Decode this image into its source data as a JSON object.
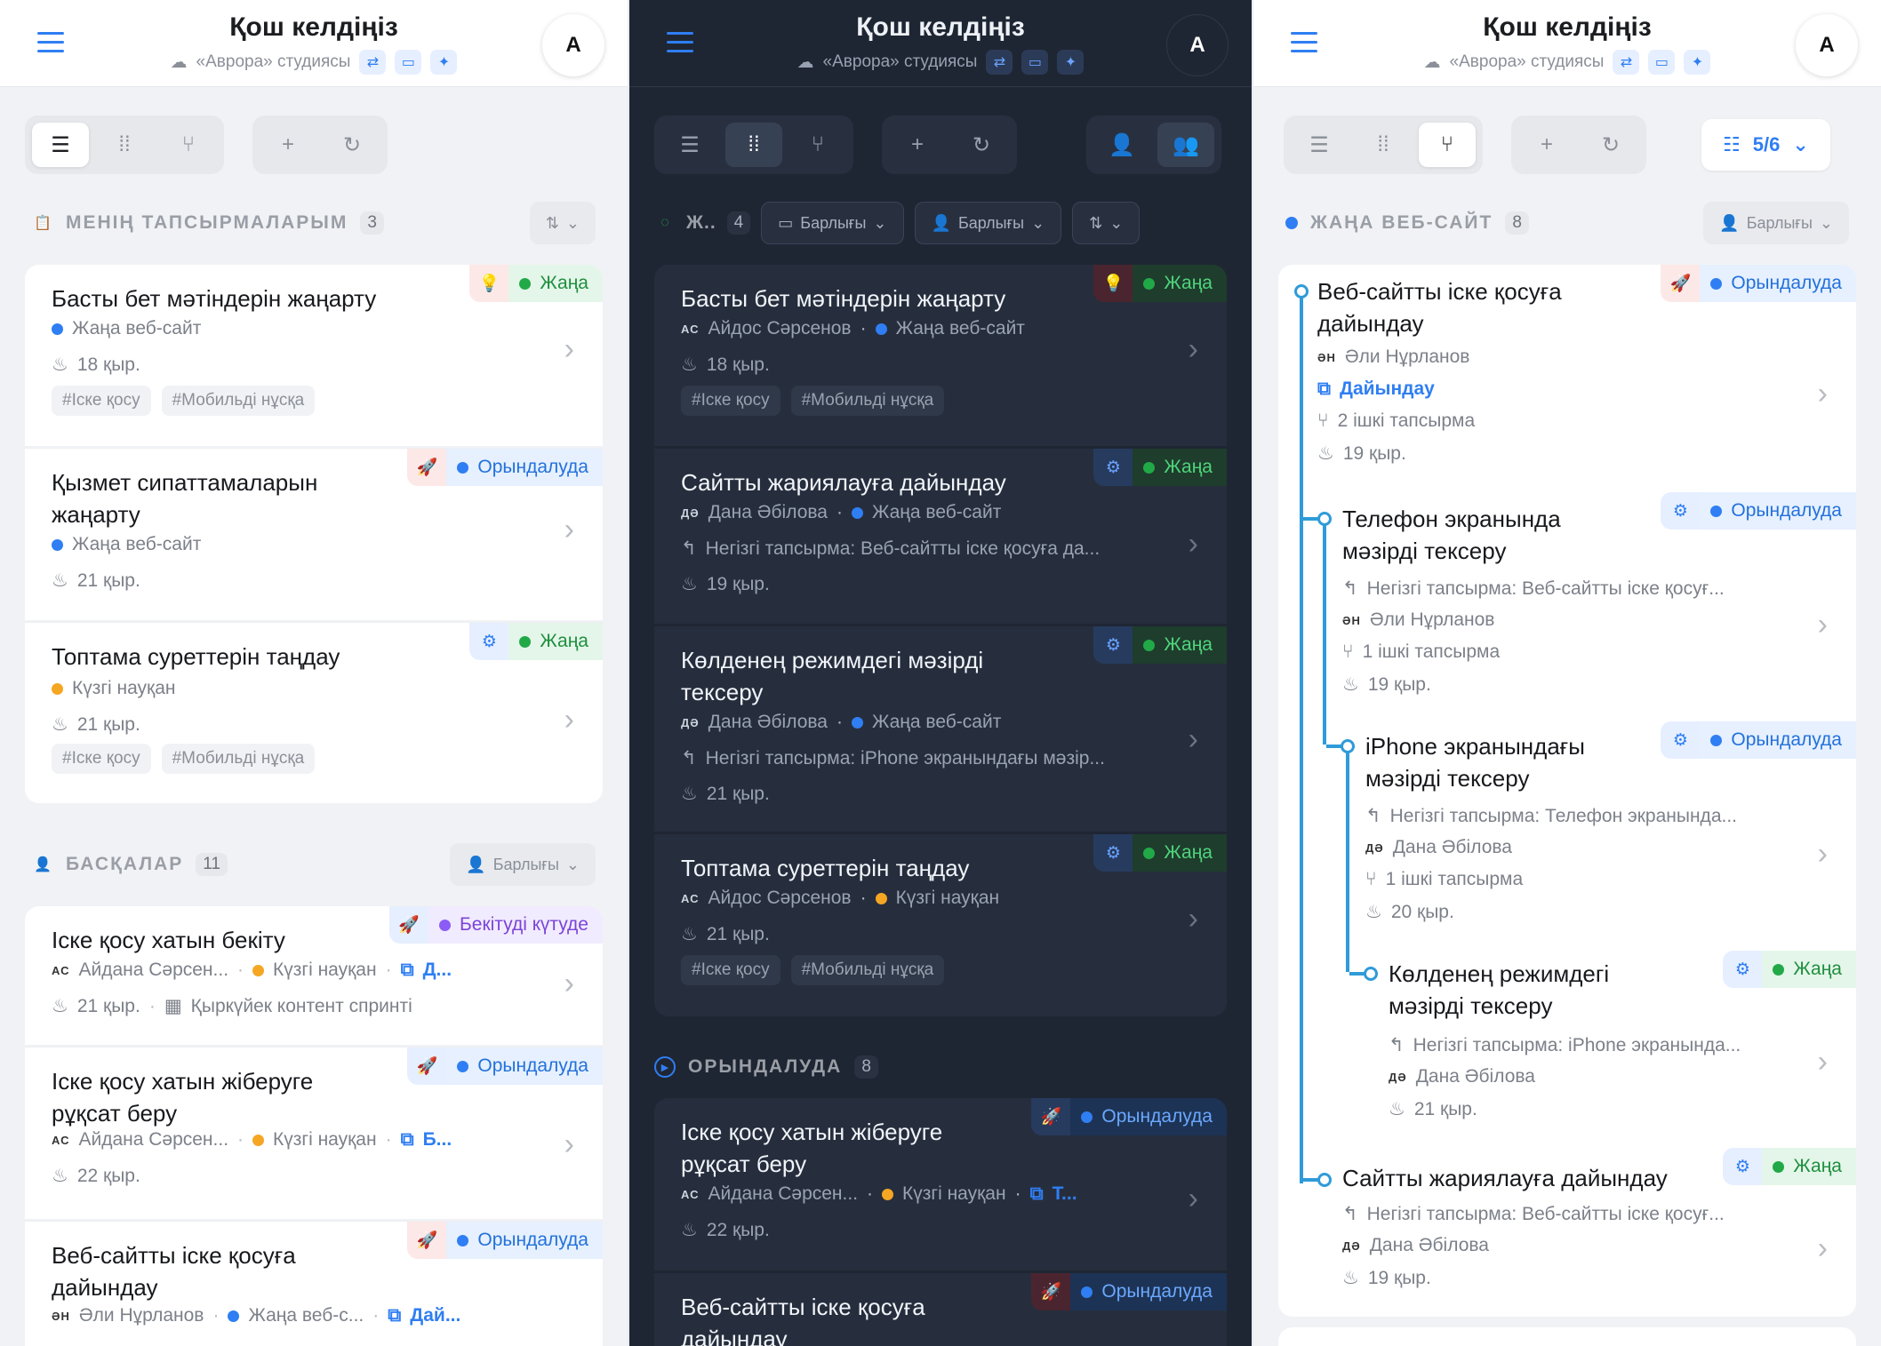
{
  "header": {
    "title": "Қош келдіңіз",
    "subtitle": "«Аврора» студиясы",
    "avatar": "A"
  },
  "panel1": {
    "mine": {
      "title": "МЕНІҢ ТАПСЫРМАЛАРЫМ",
      "count": "3"
    },
    "others": {
      "title": "БАСҚАЛАР",
      "count": "11",
      "filter": "Барлығы"
    },
    "cards": [
      {
        "title": "Басты бет мәтіндерін жаңарту",
        "status": "Жаңа",
        "project": "Жаңа веб-сайт",
        "date": "18 қыр.",
        "tag1": "#Іске қосу",
        "tag2": "#Мобильді нұсқа"
      },
      {
        "title1": "Қызмет сипаттамаларын",
        "title2": "жаңарту",
        "status": "Орындалуда",
        "project": "Жаңа веб-сайт",
        "date": "21 қыр."
      },
      {
        "title": "Топтама суреттерін таңдау",
        "status": "Жаңа",
        "project": "Күзгі науқан",
        "date": "21 қыр.",
        "tag1": "#Іске қосу",
        "tag2": "#Мобильді нұсқа"
      },
      {
        "title": "Іске қосу хатын бекіту",
        "status": "Бекітуді күтуде",
        "user_ini": "АС",
        "user": "Айдана Сәрсен...",
        "project": "Күзгі науқан",
        "link": "Д...",
        "date": "21 қыр.",
        "sprint": "Қыркүйек контент спринті"
      },
      {
        "title1": "Іске қосу хатын жіберуге",
        "title2": "рұқсат беру",
        "status": "Орындалуда",
        "user_ini": "АС",
        "user": "Айдана Сәрсен...",
        "project": "Күзгі науқан",
        "link": "Б...",
        "date": "22 қыр."
      },
      {
        "title1": "Веб-сайтты іске қосуға",
        "title2": "дайындау",
        "status": "Орындалуда",
        "user_ini": "ӘН",
        "user": "Әли Нұрланов",
        "project": "Жаңа веб-с...",
        "link": "Дай..."
      }
    ]
  },
  "panel2": {
    "group": {
      "title": "Ж..",
      "count": "4",
      "filter1": "Барлығы",
      "filter2": "Барлығы"
    },
    "run": {
      "title": "ОРЫНДАЛУДА",
      "count": "8"
    },
    "cards": [
      {
        "title": "Басты бет мәтіндерін жаңарту",
        "status": "Жаңа",
        "user_ini": "АС",
        "user": "Айдос Сәрсенов",
        "project": "Жаңа веб-сайт",
        "date": "18 қыр.",
        "tag1": "#Іске қосу",
        "tag2": "#Мобильді нұсқа"
      },
      {
        "title": "Сайтты жариялауға дайындау",
        "status": "Жаңа",
        "user_ini": "ДӘ",
        "user": "Дана Әбілова",
        "project": "Жаңа веб-сайт",
        "parent": "Негізгі тапсырма: Веб-сайтты іске қосуға да...",
        "date": "19 қыр."
      },
      {
        "title1": "Көлденең режимдегі мәзірді",
        "title2": "тексеру",
        "status": "Жаңа",
        "user_ini": "ДӘ",
        "user": "Дана Әбілова",
        "project": "Жаңа веб-сайт",
        "parent": "Негізгі тапсырма: iPhone экранындағы мәзір...",
        "date": "21 қыр."
      },
      {
        "title": "Топтама суреттерін таңдау",
        "status": "Жаңа",
        "user_ini": "АС",
        "user": "Айдос Сәрсенов",
        "project": "Күзгі науқан",
        "date": "21 қыр.",
        "tag1": "#Іске қосу",
        "tag2": "#Мобильді нұсқа"
      },
      {
        "title1": "Іске қосу хатын жіберуге",
        "title2": "рұқсат беру",
        "status": "Орындалуда",
        "user_ini": "АС",
        "user": "Айдана Сәрсен...",
        "project": "Күзгі науқан",
        "link": "Т...",
        "date": "22 қыр."
      },
      {
        "title1": "Веб-сайтты іске қосуға",
        "title2": "дайындау",
        "status": "Орындалуда"
      }
    ]
  },
  "panel3": {
    "group": {
      "title": "ЖАҢА ВЕБ-САЙТ",
      "count": "8",
      "filter": "Барлығы"
    },
    "filter_count": "5/6",
    "cards": [
      {
        "title1": "Веб-сайтты іске қосуға",
        "title2": "дайындау",
        "status": "Орындалуда",
        "user_ini": "ӘН",
        "user": "Әли Нұрланов",
        "link": "Дайындау",
        "subtasks": "2 ішкі тапсырма",
        "date": "19 қыр."
      },
      {
        "title1": "Телефон экранында",
        "title2": "мәзірді тексеру",
        "status": "Орындалуда",
        "parent": "Негізгі тапсырма: Веб-сайтты іске қосуғ...",
        "user_ini": "ӘН",
        "user": "Әли Нұрланов",
        "subtasks": "1 ішкі тапсырма",
        "date": "19 қыр."
      },
      {
        "title1": "iPhone экранындағы",
        "title2": "мәзірді тексеру",
        "status": "Орындалуда",
        "parent": "Негізгі тапсырма: Телефон экранында...",
        "user_ini": "ДӘ",
        "user": "Дана Әбілова",
        "subtasks": "1 ішкі тапсырма",
        "date": "20 қыр."
      },
      {
        "title1": "Көлденең режимдегі",
        "title2": "мәзірді тексеру",
        "status": "Жаңа",
        "parent": "Негізгі тапсырма: iPhone экранында...",
        "user_ini": "ДӘ",
        "user": "Дана Әбілова",
        "date": "21 қыр."
      },
      {
        "title": "Сайтты жариялауға дайындау",
        "status": "Жаңа",
        "parent": "Негізгі тапсырма: Веб-сайтты іске қосуғ...",
        "user_ini": "ДӘ",
        "user": "Дана Әбілова",
        "date": "19 қыр."
      }
    ]
  }
}
